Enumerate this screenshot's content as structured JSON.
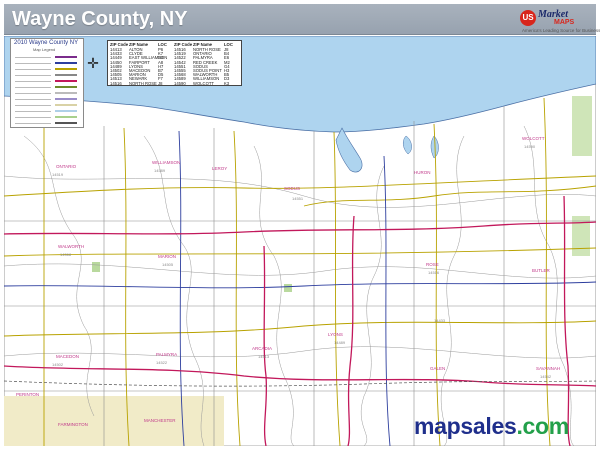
{
  "header": {
    "title": "Wayne County, NY",
    "logo": {
      "badge": "US",
      "line1": "Market",
      "line2": "MAPS",
      "tagline": "America's Leading Source for Business Maps"
    }
  },
  "legend": {
    "title": "2010 Wayne County NY",
    "subtitle": "Map Legend",
    "items": [
      {
        "color": "#7b2c8c"
      },
      {
        "color": "#2d3e9e"
      },
      {
        "color": "#b8a200"
      },
      {
        "color": "#888888"
      },
      {
        "color": "#c2185b"
      },
      {
        "color": "#6d8c2a"
      },
      {
        "color": "#bbbbbb"
      },
      {
        "color": "#9a8cc8"
      },
      {
        "color": "#d9d2a6"
      },
      {
        "color": "#aed0e8"
      },
      {
        "color": "#a8d08d"
      },
      {
        "color": "#555555"
      }
    ]
  },
  "compass": {
    "glyph": "✛"
  },
  "zip_table": {
    "headers": [
      "ZIP Code",
      "ZIP Name",
      "LOC",
      "ZIP Code",
      "ZIP Name",
      "LOC"
    ],
    "rows": [
      [
        "14413",
        "ALTON",
        "P6",
        "14516",
        "NORTH ROSE",
        "J8"
      ],
      [
        "14433",
        "CLYDE",
        "K7",
        "14519",
        "ONTARIO",
        "B4"
      ],
      [
        "14449",
        "EAST WILLIAMSON",
        "D3",
        "14522",
        "PALMYRA",
        "E6"
      ],
      [
        "14450",
        "FAIRPORT",
        "A8",
        "14542",
        "RED CREEK",
        "M2"
      ],
      [
        "14489",
        "LYONS",
        "H7",
        "14551",
        "SODUS",
        "G4"
      ],
      [
        "14502",
        "MACEDON",
        "B7",
        "14555",
        "SODUS POINT",
        "H3"
      ],
      [
        "14505",
        "MARION",
        "D5",
        "14568",
        "WALWORTH",
        "B5"
      ],
      [
        "14513",
        "NEWARK",
        "F7",
        "14589",
        "WILLIAMSON",
        "D3"
      ],
      [
        "14516",
        "NORTH ROSE",
        "J8",
        "14590",
        "WOLCOTT",
        "K3"
      ]
    ]
  },
  "places": [
    {
      "name": "ONTARIO"
    },
    {
      "name": "WILLIAMSON"
    },
    {
      "name": "SODUS"
    },
    {
      "name": "HURON"
    },
    {
      "name": "WOLCOTT"
    },
    {
      "name": "WALWORTH"
    },
    {
      "name": "MARION"
    },
    {
      "name": "ROSE"
    },
    {
      "name": "BUTLER"
    },
    {
      "name": "LYONS"
    },
    {
      "name": "PALMYRA"
    },
    {
      "name": "MACEDON"
    },
    {
      "name": "ARCADIA"
    },
    {
      "name": "GALEN"
    },
    {
      "name": "SAVANNAH"
    },
    {
      "name": "MANCHESTER"
    },
    {
      "name": "FARMINGTON"
    },
    {
      "name": "PERINTON"
    },
    {
      "name": "LEROY"
    }
  ],
  "zip_labels": [
    {
      "text": "14519"
    },
    {
      "text": "14589"
    },
    {
      "text": "14551"
    },
    {
      "text": "14590"
    },
    {
      "text": "14568"
    },
    {
      "text": "14505"
    },
    {
      "text": "14516"
    },
    {
      "text": "14433"
    },
    {
      "text": "14489"
    },
    {
      "text": "14513"
    },
    {
      "text": "14522"
    },
    {
      "text": "14502"
    },
    {
      "text": "14542"
    }
  ],
  "watermark": {
    "part1": "mapsales",
    "part2": ".com"
  }
}
